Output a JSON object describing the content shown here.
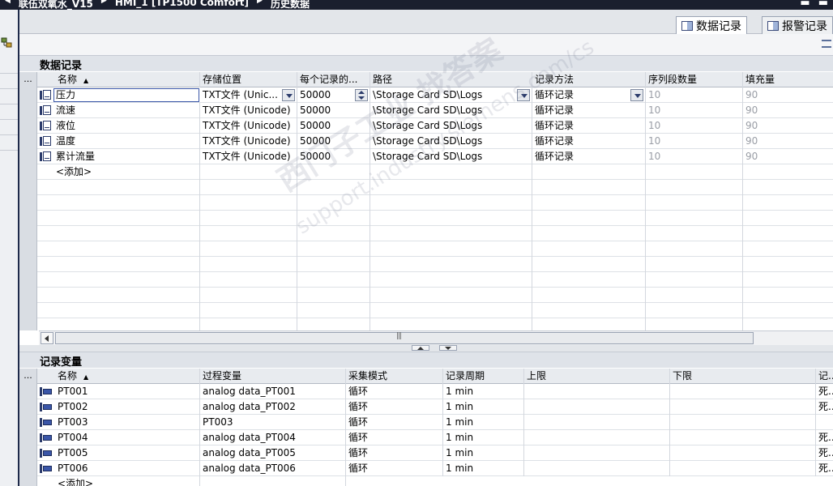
{
  "title": {
    "crumbs": [
      "联伍双氧水_V15",
      "HMI_1 [TP1500 Comfort]",
      "历史数据"
    ]
  },
  "tabs": [
    {
      "label": "数据记录",
      "active": true
    },
    {
      "label": "报警记录",
      "active": false
    }
  ],
  "data_logs": {
    "section_title": "数据记录",
    "columns": [
      "...",
      "名称",
      "存储位置",
      "每个记录的...",
      "路径",
      "记录方法",
      "序列段数量",
      "填充量"
    ],
    "rows": [
      {
        "name": "压力",
        "storage": "TXT文件 (Unic...",
        "records": "50000",
        "path": "\\Storage Card SD\\Logs",
        "method": "循环记录",
        "segments": "10",
        "fill": "90"
      },
      {
        "name": "流速",
        "storage": "TXT文件 (Unicode)",
        "records": "50000",
        "path": "\\Storage Card SD\\Logs",
        "method": "循环记录",
        "segments": "10",
        "fill": "90"
      },
      {
        "name": "液位",
        "storage": "TXT文件 (Unicode)",
        "records": "50000",
        "path": "\\Storage Card SD\\Logs",
        "method": "循环记录",
        "segments": "10",
        "fill": "90"
      },
      {
        "name": "温度",
        "storage": "TXT文件 (Unicode)",
        "records": "50000",
        "path": "\\Storage Card SD\\Logs",
        "method": "循环记录",
        "segments": "10",
        "fill": "90"
      },
      {
        "name": "累计流量",
        "storage": "TXT文件 (Unicode)",
        "records": "50000",
        "path": "\\Storage Card SD\\Logs",
        "method": "循环记录",
        "segments": "10",
        "fill": "90"
      }
    ],
    "add_label": "<添加>"
  },
  "log_tags": {
    "section_title": "记录变量",
    "columns": [
      "...",
      "名称",
      "过程变量",
      "采集模式",
      "记录周期",
      "上限",
      "下限",
      "记..."
    ],
    "rows": [
      {
        "name": "PT001",
        "tag": "analog data_PT001",
        "mode": "循环",
        "cycle": "1 min",
        "high": "",
        "low": "",
        "extra": "死..."
      },
      {
        "name": "PT002",
        "tag": "analog data_PT002",
        "mode": "循环",
        "cycle": "1 min",
        "high": "",
        "low": "",
        "extra": "死..."
      },
      {
        "name": "PT003",
        "tag": "PT003",
        "mode": "循环",
        "cycle": "1 min",
        "high": "",
        "low": "",
        "extra": ""
      },
      {
        "name": "PT004",
        "tag": "analog data_PT004",
        "mode": "循环",
        "cycle": "1 min",
        "high": "",
        "low": "",
        "extra": "死..."
      },
      {
        "name": "PT005",
        "tag": "analog data_PT005",
        "mode": "循环",
        "cycle": "1 min",
        "high": "",
        "low": "",
        "extra": "死..."
      },
      {
        "name": "PT006",
        "tag": "analog data_PT006",
        "mode": "循环",
        "cycle": "1 min",
        "high": "",
        "low": "",
        "extra": "死..."
      }
    ],
    "add_label": "<添加>"
  },
  "watermark": {
    "line1": "西门子工业  找答案",
    "line2": "support.industry.siemens.com/cs"
  }
}
